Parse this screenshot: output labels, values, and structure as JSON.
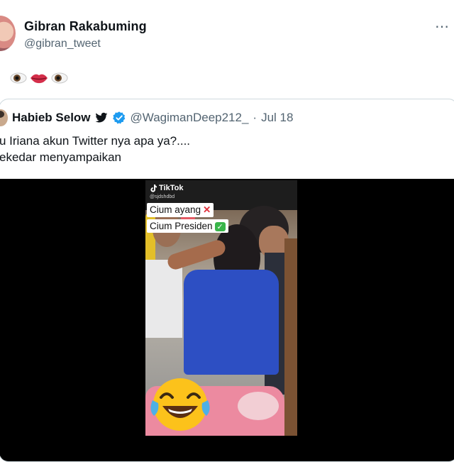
{
  "tweet": {
    "author_name": "Gibran Rakabuming",
    "author_handle": "@gibran_tweet",
    "emojis": [
      "eyes-left",
      "lips",
      "eyes-right"
    ]
  },
  "quoted_tweet": {
    "author_name": "Habieb Selow",
    "author_handle": "@WagimanDeep212_",
    "separator": "·",
    "date": "Jul 18",
    "line1": "u Iriana akun Twitter nya apa ya?....",
    "line2": "ekedar menyampaikan"
  },
  "media": {
    "watermark": "TikTok",
    "watermark_user": "@sjdshdbd",
    "caption1": "Cium ayang",
    "caption2": "Cium Presiden",
    "caption1_mark": "✕",
    "caption2_mark": "✓"
  },
  "colors": {
    "verified": "#1d9bf0",
    "secondary_text": "#536471",
    "border": "#cfd9de"
  }
}
